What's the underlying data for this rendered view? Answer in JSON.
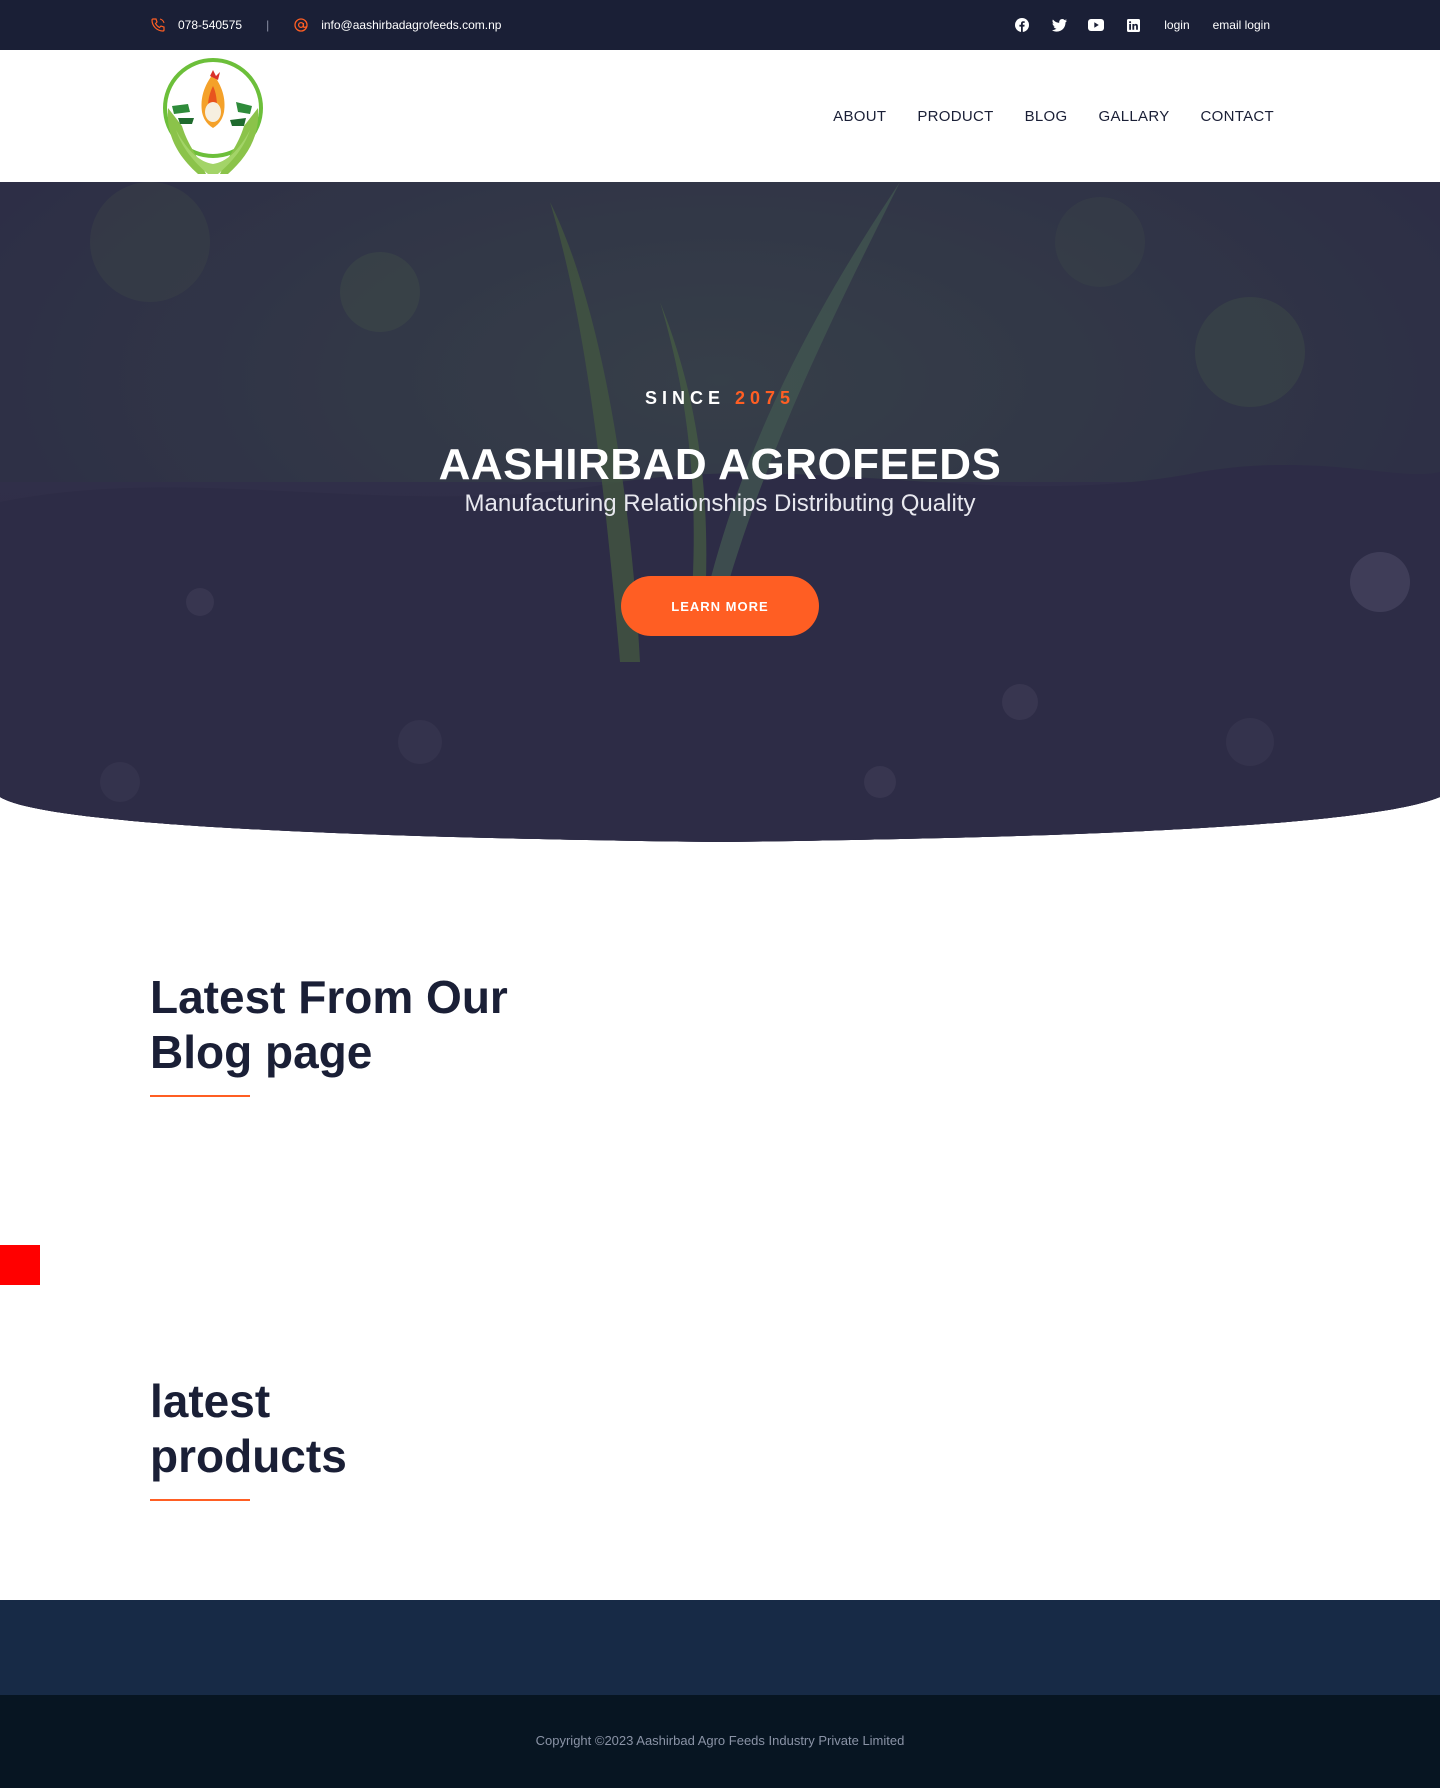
{
  "topbar": {
    "phone": "078-540575",
    "separator": "|",
    "email": "info@aashirbadagrofeeds.com.np",
    "social_icons": [
      "facebook-icon",
      "twitter-icon",
      "youtube-icon",
      "linkedin-icon"
    ],
    "login": "login",
    "email_login": "email login"
  },
  "nav": {
    "items": [
      "ABOUT",
      "PRODUCT",
      "BLOG",
      "GALLARY",
      "CONTACT"
    ]
  },
  "hero": {
    "since_label": "SINCE",
    "since_year": "2075",
    "title": "AASHIRBAD AGROFEEDS",
    "subtitle": "Manufacturing Relationships Distributing Quality",
    "button": "LEARN MORE"
  },
  "blog_section": {
    "title_line1": "Latest From Our",
    "title_line2": "Blog page"
  },
  "products_section": {
    "title_line1": "latest",
    "title_line2": "products"
  },
  "footer": {
    "copyright": "Copyright ©2023 Aashirbad Agro Feeds Industry Private Limited"
  },
  "colors": {
    "dark_navy": "#1a1f36",
    "accent_orange": "#ff5e23",
    "footer_top": "#172a46",
    "footer_bottom": "#071522",
    "red_box": "#ff0000"
  }
}
